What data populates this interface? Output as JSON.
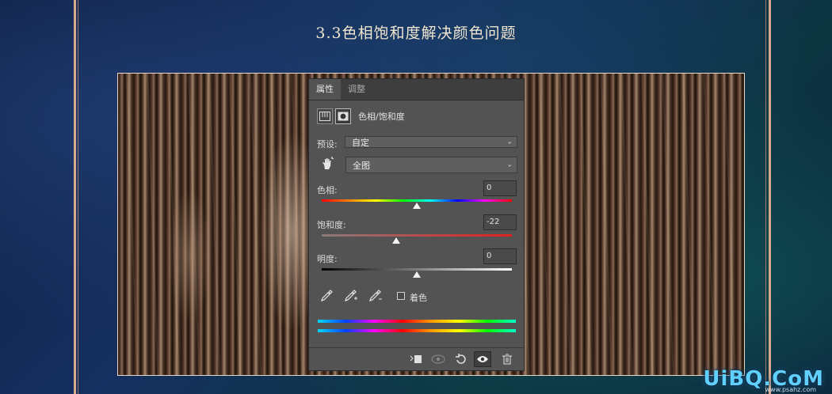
{
  "heading": "3.3色相饱和度解决颜色问题",
  "panel": {
    "tabs": [
      {
        "label": "属性"
      },
      {
        "label": "调整"
      }
    ],
    "title": "色相/饱和度",
    "preset_label": "预设:",
    "preset_value": "自定",
    "channel_value": "全图",
    "hue": {
      "label": "色相:",
      "value": "0",
      "level": 0.5
    },
    "saturation": {
      "label": "饱和度:",
      "value": "-22",
      "level": 0.39
    },
    "lightness": {
      "label": "明度:",
      "value": "0",
      "level": 0.5
    },
    "colorize_label": "着色",
    "colorize_checked": false
  },
  "icons": {
    "adjustment_layer": "hue-saturation-icon",
    "mask": "mask-icon",
    "hand_tool": "targeted-adjustment-hand-icon",
    "eyedropper": "eyedropper-icon",
    "eyedropper_add": "eyedropper-plus-icon",
    "eyedropper_subtract": "eyedropper-minus-icon",
    "clip": "clip-to-layer-icon",
    "view_previous": "view-previous-state-icon",
    "reset": "reset-icon",
    "visibility": "eye-icon",
    "delete": "trash-icon"
  },
  "watermark": {
    "main": "UiBQ.CoM",
    "sub": "www.psahz.com"
  }
}
